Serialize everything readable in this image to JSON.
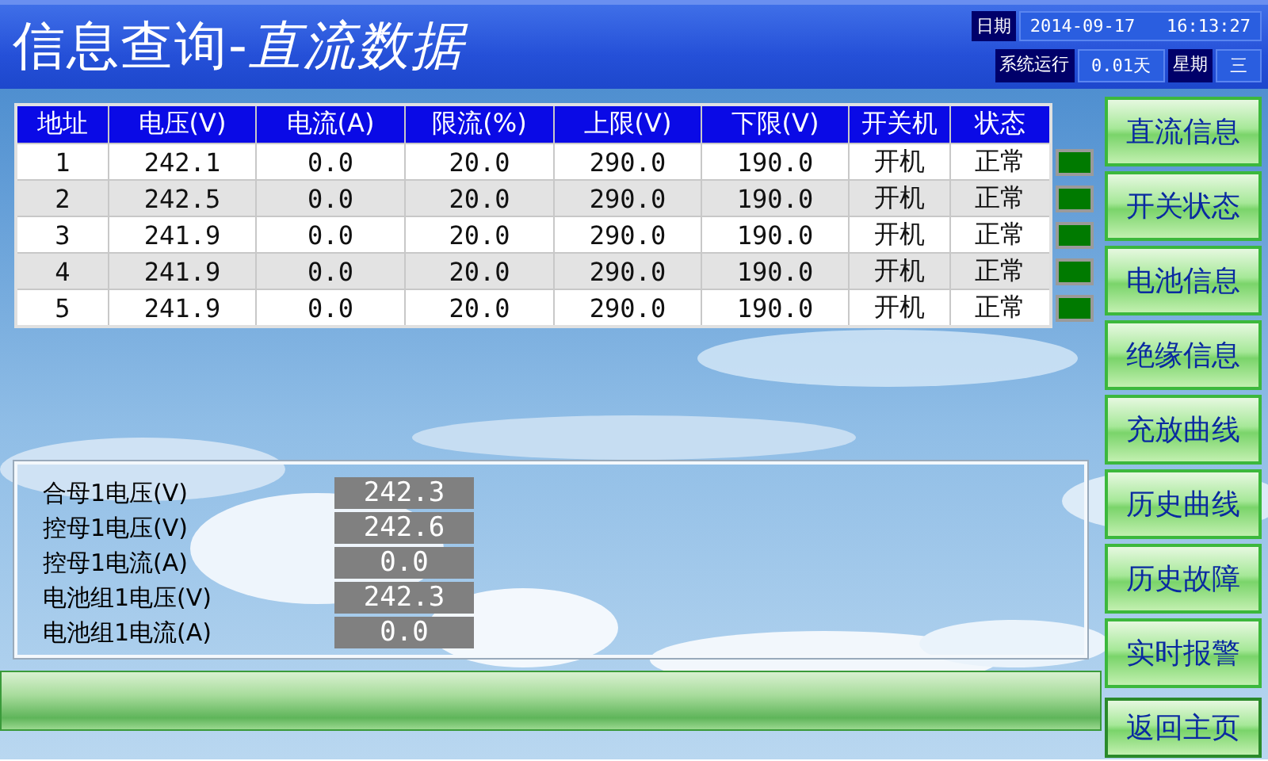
{
  "window": {
    "title_prefix": "信息查询-",
    "title_suffix": "直流数据"
  },
  "status": {
    "date_label": "日期",
    "date": "2014-09-17",
    "time": "16:13:27",
    "runtime_label": "系统运行",
    "runtime": "0.01天",
    "weekday_label": "星期",
    "weekday": "三"
  },
  "table": {
    "columns": [
      "地址",
      "电压(V)",
      "电流(A)",
      "限流(%)",
      "上限(V)",
      "下限(V)",
      "开关机",
      "状态"
    ],
    "rows": [
      {
        "cells": [
          "1",
          "242.1",
          "0.0",
          "20.0",
          "290.0",
          "190.0",
          "开机",
          "正常"
        ],
        "ok": true
      },
      {
        "cells": [
          "2",
          "242.5",
          "0.0",
          "20.0",
          "290.0",
          "190.0",
          "开机",
          "正常"
        ],
        "ok": true
      },
      {
        "cells": [
          "3",
          "241.9",
          "0.0",
          "20.0",
          "290.0",
          "190.0",
          "开机",
          "正常"
        ],
        "ok": true
      },
      {
        "cells": [
          "4",
          "241.9",
          "0.0",
          "20.0",
          "290.0",
          "190.0",
          "开机",
          "正常"
        ],
        "ok": true
      },
      {
        "cells": [
          "5",
          "241.9",
          "0.0",
          "20.0",
          "290.0",
          "190.0",
          "开机",
          "正常"
        ],
        "ok": true
      }
    ]
  },
  "summary": [
    {
      "label": "合母1电压(V)",
      "value": "242.3"
    },
    {
      "label": "控母1电压(V)",
      "value": "242.6"
    },
    {
      "label": "控母1电流(A)",
      "value": "0.0"
    },
    {
      "label": "电池组1电压(V)",
      "value": "242.3"
    },
    {
      "label": "电池组1电流(A)",
      "value": "0.0"
    }
  ],
  "nav": [
    "直流信息",
    "开关状态",
    "电池信息",
    "绝缘信息",
    "充放曲线",
    "历史曲线",
    "历史故障",
    "实时报警"
  ],
  "home_button": "返回主页"
}
